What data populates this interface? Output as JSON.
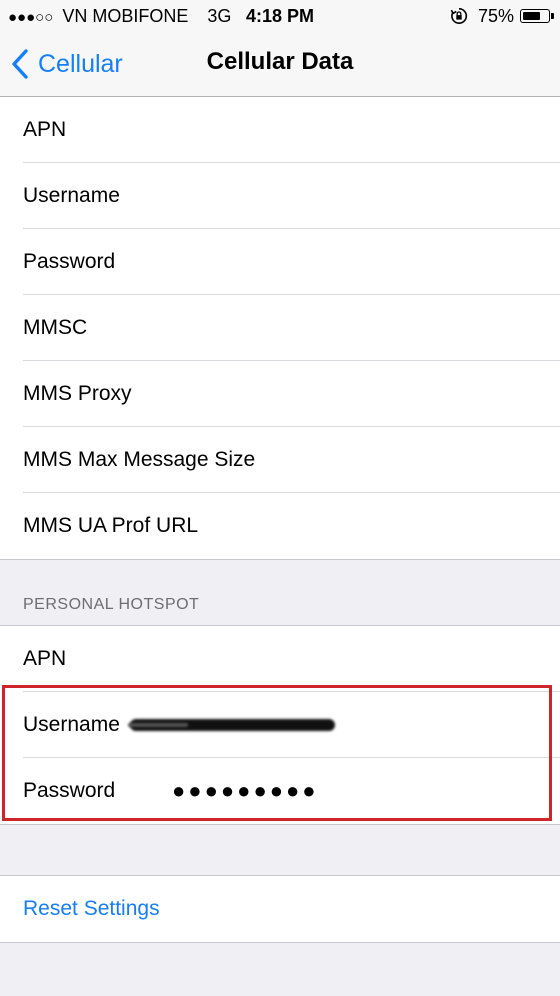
{
  "statusbar": {
    "signal_dots": "●●●○○",
    "carrier": "VN MOBIFONE",
    "network": "3G",
    "time": "4:18 PM",
    "battery_percent": "75%",
    "battery_level": 0.75,
    "lock_icon": "orientation-lock-icon"
  },
  "navbar": {
    "back_label": "Cellular",
    "title": "Cellular Data"
  },
  "mms_group": {
    "rows": [
      {
        "label": "APN"
      },
      {
        "label": "Username"
      },
      {
        "label": "Password"
      },
      {
        "label": "MMSC"
      },
      {
        "label": "MMS Proxy"
      },
      {
        "label": "MMS Max Message Size"
      },
      {
        "label": "MMS UA Prof URL"
      }
    ]
  },
  "hotspot": {
    "header": "PERSONAL HOTSPOT",
    "apn_label": "APN",
    "username_label": "Username",
    "password_label": "Password",
    "password_value": "●●●●●●●●●"
  },
  "reset": {
    "label": "Reset Settings"
  },
  "colors": {
    "accent": "#147efb",
    "highlight": "#d0242b",
    "background": "#efeff4"
  }
}
